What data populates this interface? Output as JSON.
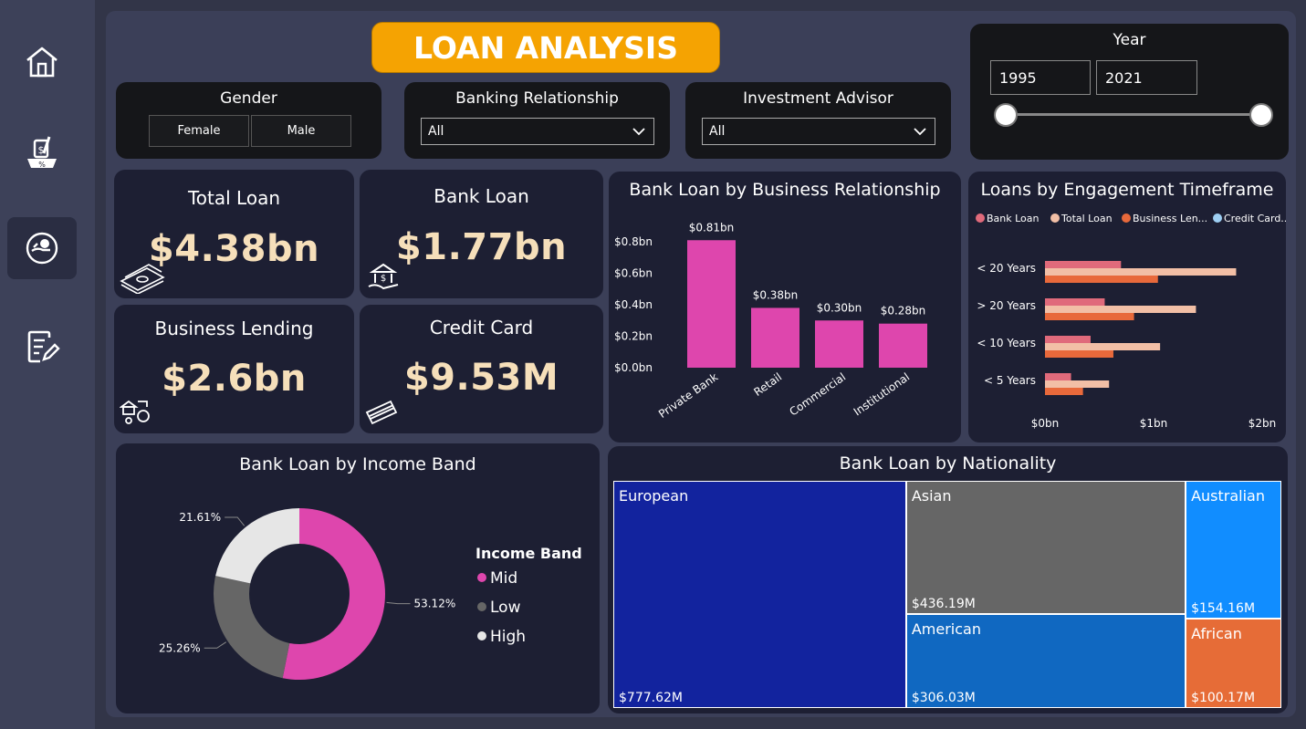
{
  "header": {
    "title": "LOAN ANALYSIS"
  },
  "nav": [
    {
      "icon": "home-icon",
      "active": false
    },
    {
      "icon": "loan-tax-icon",
      "active": false
    },
    {
      "icon": "loan-hand-icon",
      "active": true
    },
    {
      "icon": "report-edit-icon",
      "active": false
    }
  ],
  "filters": {
    "gender": {
      "title": "Gender",
      "options": [
        "Female",
        "Male"
      ]
    },
    "banking_relationship": {
      "title": "Banking Relationship",
      "value": "All"
    },
    "investment_advisor": {
      "title": "Investment Advisor",
      "value": "All"
    },
    "year": {
      "title": "Year",
      "from": "1995",
      "to": "2021"
    }
  },
  "kpis": {
    "total_loan": {
      "title": "Total Loan",
      "value": "$4.38bn",
      "icon": "money-stack-icon"
    },
    "bank_loan": {
      "title": "Bank Loan",
      "value": "$1.77bn",
      "icon": "bank-hand-icon"
    },
    "business_lending": {
      "title": "Business Lending",
      "value": "$2.6bn",
      "icon": "business-transfer-icon"
    },
    "credit_card": {
      "title": "Credit Card",
      "value": "$9.53M",
      "icon": "credit-card-icon"
    }
  },
  "chart_data": [
    {
      "type": "bar",
      "title": "Bank Loan by Business Relationship",
      "categories": [
        "Private Bank",
        "Retail",
        "Commercial",
        "Institutional"
      ],
      "values": [
        0.81,
        0.38,
        0.3,
        0.28
      ],
      "data_labels": [
        "$0.81bn",
        "$0.38bn",
        "$0.30bn",
        "$0.28bn"
      ],
      "yticks": [
        "$0.0bn",
        "$0.2bn",
        "$0.4bn",
        "$0.6bn",
        "$0.8bn"
      ],
      "ylim": [
        0,
        0.9
      ],
      "color": "#de46ad"
    },
    {
      "type": "bar",
      "orientation": "horizontal",
      "title": "Loans by Engagement Timeframe",
      "categories": [
        "< 20 Years",
        "> 20 Years",
        "< 10 Years",
        "< 5 Years"
      ],
      "series": [
        {
          "name": "Bank Loan",
          "color": "#e06a7b",
          "values": [
            0.7,
            0.55,
            0.42,
            0.24
          ]
        },
        {
          "name": "Total Loan",
          "color": "#f2bfa6",
          "values": [
            1.76,
            1.39,
            1.06,
            0.59
          ]
        },
        {
          "name": "Business Len...",
          "color": "#e8693b",
          "values": [
            1.04,
            0.82,
            0.63,
            0.35
          ]
        },
        {
          "name": "Credit Card...",
          "color": "#9ecff3",
          "values": [
            0.01,
            0.01,
            0.01,
            0.0
          ]
        }
      ],
      "xticks": [
        "$0bn",
        "$1bn",
        "$2bn"
      ],
      "xlim": [
        0,
        2
      ]
    },
    {
      "type": "pie",
      "title": "Bank Loan by Income Band",
      "legend_title": "Income Band",
      "labels": [
        "Mid",
        "Low",
        "High"
      ],
      "values": [
        53.12,
        25.26,
        21.61
      ],
      "data_labels": [
        "53.12%",
        "25.26%",
        "21.61%"
      ],
      "colors": [
        "#de46ad",
        "#666666",
        "#e6e6e6"
      ]
    },
    {
      "type": "treemap",
      "title": "Bank Loan by Nationality",
      "labels": [
        "European",
        "Asian",
        "American",
        "Australian",
        "African"
      ],
      "values": [
        777.62,
        436.19,
        306.03,
        154.16,
        100.17
      ],
      "data_labels": [
        "$777.62M",
        "$436.19M",
        "$306.03M",
        "$154.16M",
        "$100.17M"
      ],
      "colors": [
        "#12239e",
        "#666666",
        "#1068c1",
        "#118dff",
        "#e66c37"
      ]
    }
  ]
}
